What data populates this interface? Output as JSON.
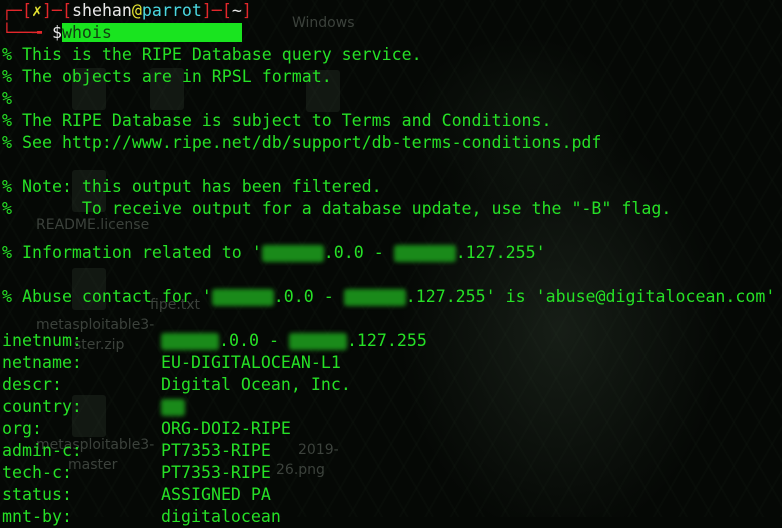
{
  "desktop": {
    "labels": [
      "Windows",
      "README.license",
      "metasploitable3-",
      "ster.zip",
      "metasploitable3-",
      "master",
      "2019-",
      "26.png",
      "fipe.txt"
    ]
  },
  "prompt": {
    "bracket_open": "┌─[",
    "status": "✗",
    "bracket_mid": "]─[",
    "user": "shehan",
    "at": "@",
    "host": "parrot",
    "bracket_mid2": "]─[",
    "dir": "~",
    "bracket_close": "]",
    "line2_prefix": "└──╼ ",
    "dollar": "$",
    "command": "whois "
  },
  "output": {
    "l1": "% This is the RIPE Database query service.",
    "l2": "% The objects are in RPSL format.",
    "l3": "%",
    "l4": "% The RIPE Database is subject to Terms and Conditions.",
    "l5": "% See http://www.ripe.net/db/support/db-terms-conditions.pdf",
    "l6": "% Note: this output has been filtered.",
    "l7": "%       To receive output for a database update, use the \"-B\" flag.",
    "info_prefix": "% Information related to '",
    "info_mid1": ".0.0 - ",
    "info_mid2": ".127.255'",
    "abuse_prefix": "% Abuse contact for '",
    "abuse_mid1": ".0.0 - ",
    "abuse_mid2": ".127.255' is 'abuse@digitalocean.com'"
  },
  "fields": {
    "inetnum_key": "inetnum:",
    "inetnum_mid1": ".0.0 - ",
    "inetnum_mid2": ".127.255",
    "netname_key": "netname:",
    "netname_val": "EU-DIGITALOCEAN-L1",
    "descr_key": "descr:",
    "descr_val": "Digital Ocean, Inc.",
    "country_key": "country:",
    "org_key": "org:",
    "org_val": "ORG-DOI2-RIPE",
    "admin_key": "admin-c:",
    "admin_val": "PT7353-RIPE",
    "tech_key": "tech-c:",
    "tech_val": "PT7353-RIPE",
    "status_key": "status:",
    "status_val": "ASSIGNED PA",
    "mnt_key": "mnt-by:",
    "mnt_val": "digitalocean"
  }
}
